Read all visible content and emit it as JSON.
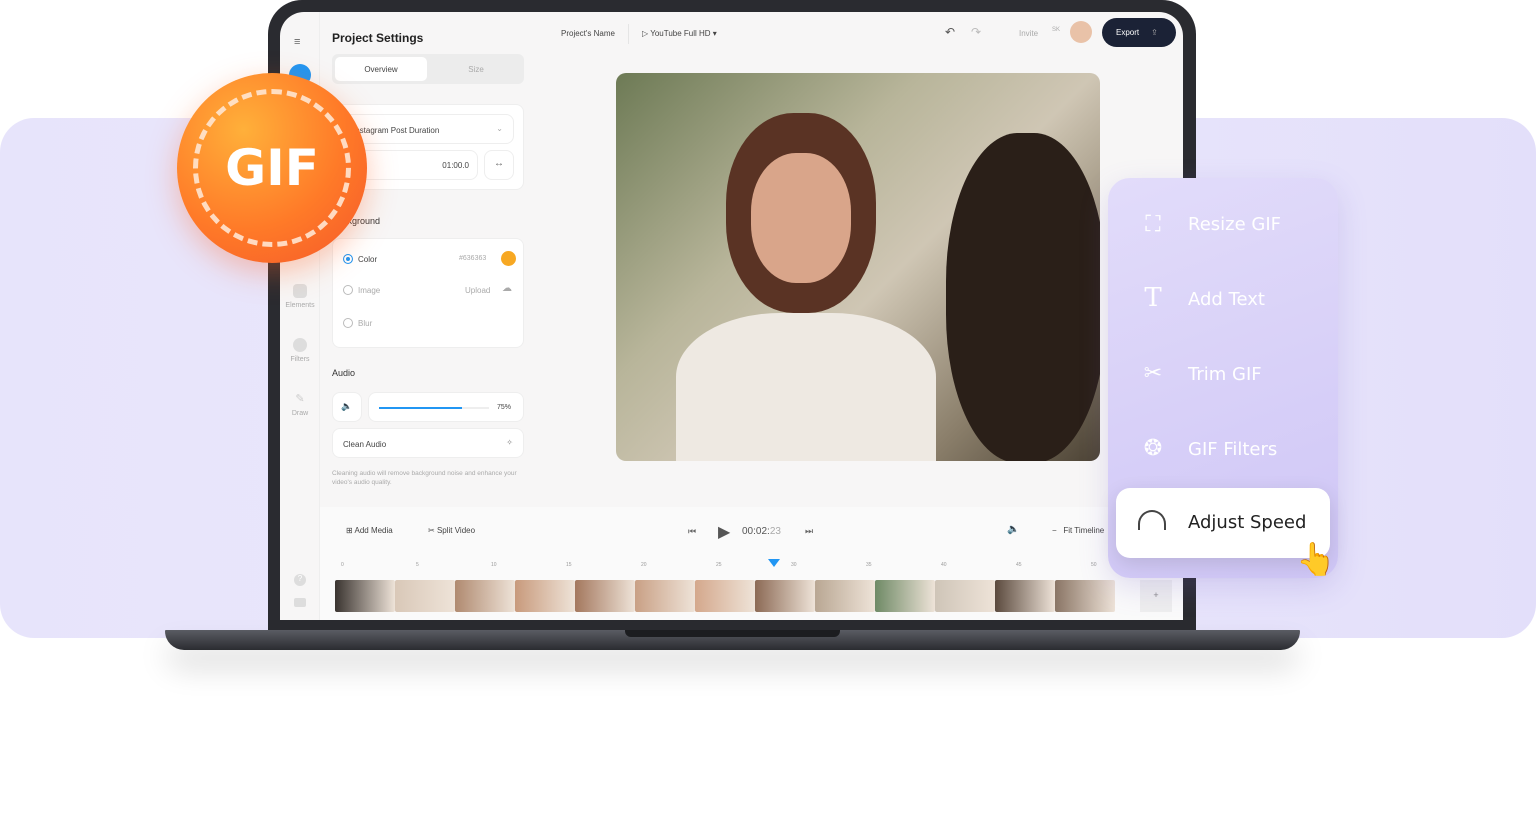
{
  "header": {
    "title": "Project Settings",
    "project_name": "Project's Name",
    "format": "YouTube Full HD",
    "invite": "Invite",
    "user_initials": "SK",
    "export": "Export"
  },
  "tabs": [
    {
      "label": "Overview",
      "active": true
    },
    {
      "label": "Size",
      "active": false
    }
  ],
  "sidebar": {
    "items": [
      {
        "label": "Elements"
      },
      {
        "label": "Filters"
      },
      {
        "label": "Draw"
      }
    ]
  },
  "duration": {
    "preset": "Instagram Post Duration",
    "value": "01:00.0"
  },
  "background": {
    "heading": "Background",
    "options": [
      {
        "label": "Color",
        "value": "#636363",
        "selected": true
      },
      {
        "label": "Image",
        "value": "Upload",
        "selected": false
      },
      {
        "label": "Blur",
        "selected": false
      }
    ],
    "accent": "#f7a823"
  },
  "audio": {
    "heading": "Audio",
    "volume": "75%",
    "volume_fraction": 0.75,
    "clean_label": "Clean Audio",
    "clean_help": "Cleaning audio will remove background noise and enhance your video's audio quality."
  },
  "timeline": {
    "add_media": "Add Media",
    "split_video": "Split Video",
    "time_main": "00:02:",
    "time_frames": "23",
    "fit": "Fit Timeline",
    "ticks": [
      "0",
      "5",
      "10",
      "15",
      "20",
      "25",
      "30",
      "35",
      "40",
      "45",
      "50"
    ],
    "playhead_seconds": 28.7,
    "accent": "#2196f3",
    "add": "+"
  },
  "gif_badge": "GIF",
  "features": [
    {
      "label": "Resize GIF",
      "icon": "crop-icon"
    },
    {
      "label": "Add Text",
      "icon": "text-icon"
    },
    {
      "label": "Trim GIF",
      "icon": "scissors-icon"
    },
    {
      "label": "GIF Filters",
      "icon": "filters-icon"
    },
    {
      "label": "Adjust Speed",
      "icon": "speedometer-icon",
      "active": true
    }
  ]
}
